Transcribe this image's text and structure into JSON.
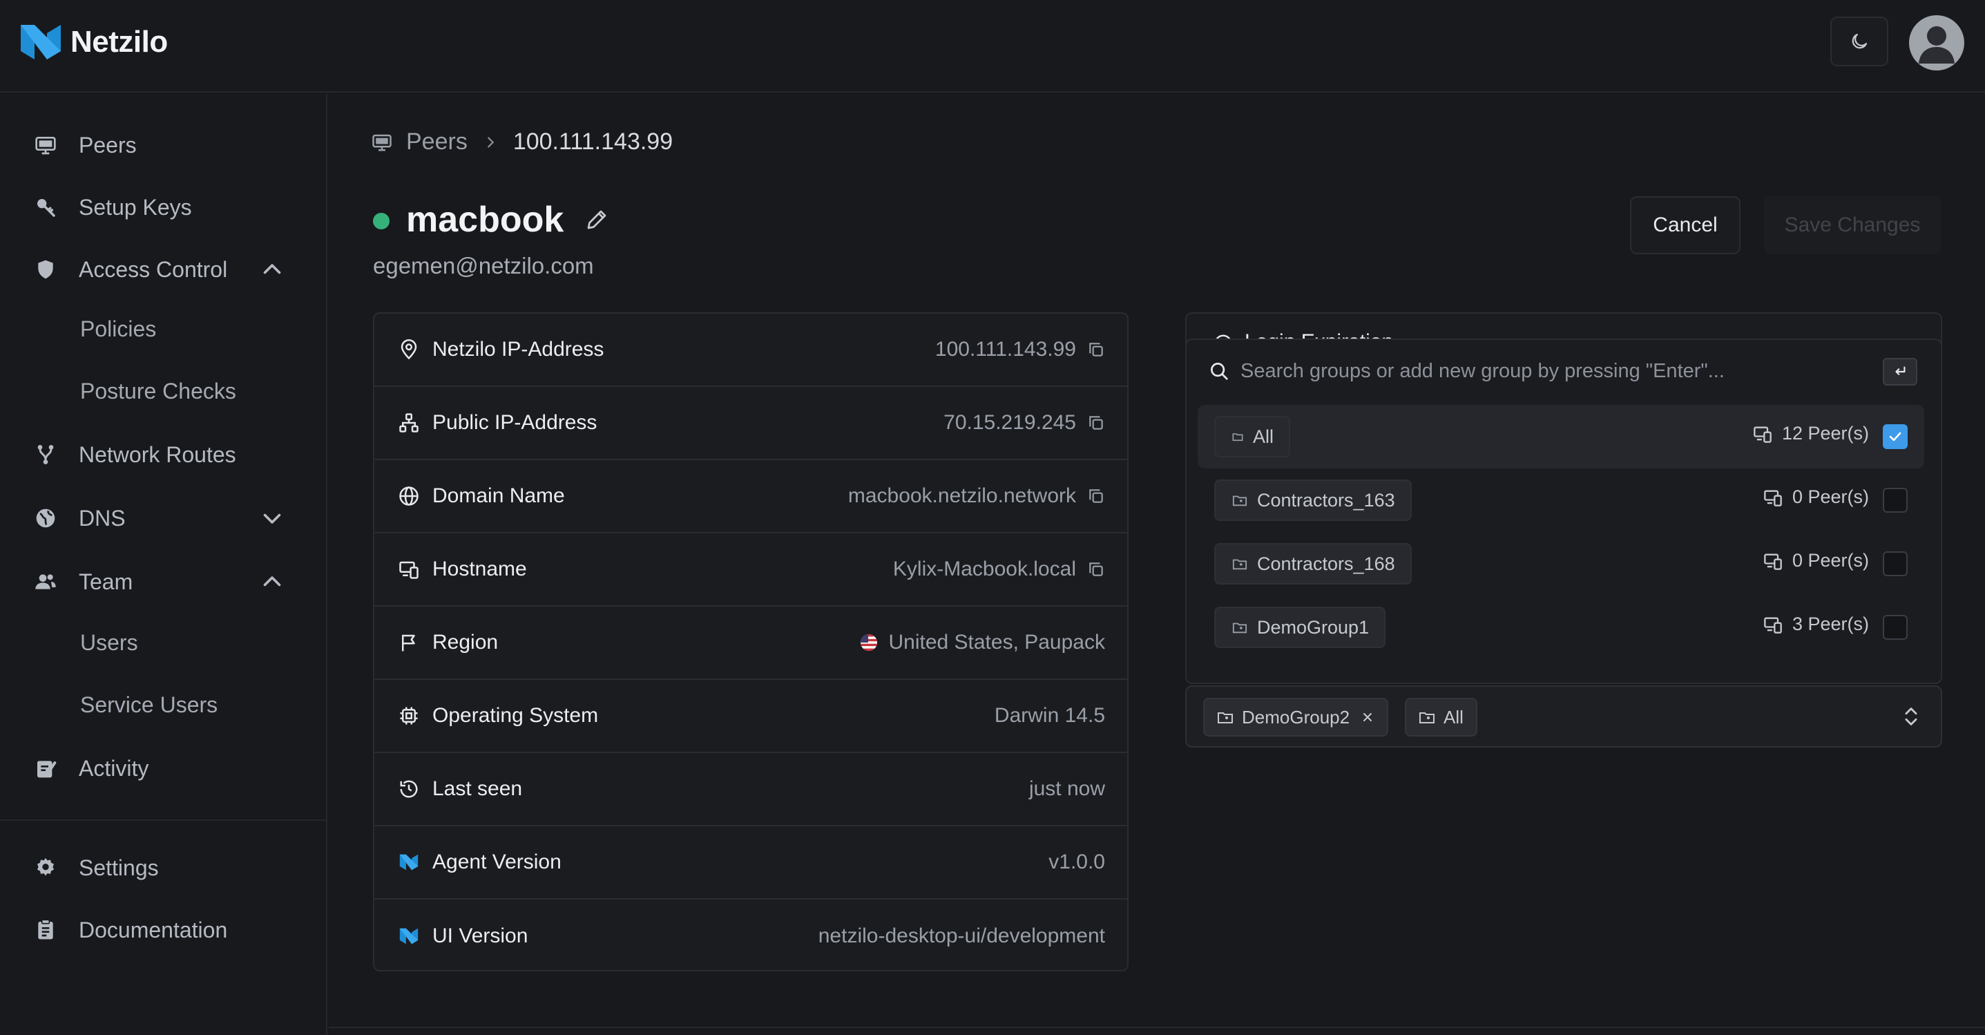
{
  "app": {
    "name": "Netzilo"
  },
  "sidebar": {
    "items": [
      {
        "label": "Peers",
        "icon": "monitor-icon"
      },
      {
        "label": "Setup Keys",
        "icon": "key-icon"
      },
      {
        "label": "Access Control",
        "icon": "shield-icon",
        "expanded": true
      },
      {
        "label": "Policies"
      },
      {
        "label": "Posture Checks"
      },
      {
        "label": "Network Routes",
        "icon": "route-icon"
      },
      {
        "label": "DNS",
        "icon": "globe-icon",
        "expanded": false
      },
      {
        "label": "Team",
        "icon": "users-icon",
        "expanded": true
      },
      {
        "label": "Users"
      },
      {
        "label": "Service Users"
      },
      {
        "label": "Activity",
        "icon": "activity-icon"
      },
      {
        "label": "Settings",
        "icon": "gear-icon"
      },
      {
        "label": "Documentation",
        "icon": "document-icon"
      }
    ]
  },
  "breadcrumb": {
    "root": "Peers",
    "current": "100.111.143.99"
  },
  "peer": {
    "name": "macbook",
    "email": "egemen@netzilo.com",
    "status_color": "#35b27a"
  },
  "actions": {
    "cancel": "Cancel",
    "save": "Save Changes"
  },
  "info": {
    "rows": [
      {
        "label": "Netzilo IP-Address",
        "value": "100.111.143.99",
        "icon": "map-pin-icon",
        "copy": true
      },
      {
        "label": "Public IP-Address",
        "value": "70.15.219.245",
        "icon": "network-icon",
        "copy": true
      },
      {
        "label": "Domain Name",
        "value": "macbook.netzilo.network",
        "icon": "globe-icon",
        "copy": true
      },
      {
        "label": "Hostname",
        "value": "Kylix-Macbook.local",
        "icon": "devices-icon",
        "copy": true
      },
      {
        "label": "Region",
        "value": "United States, Paupack",
        "icon": "flag-icon",
        "copy": false
      },
      {
        "label": "Operating System",
        "value": "Darwin 14.5",
        "icon": "cpu-icon",
        "copy": false
      },
      {
        "label": "Last seen",
        "value": "just now",
        "icon": "history-icon",
        "copy": false
      },
      {
        "label": "Agent Version",
        "value": "v1.0.0",
        "icon": "netzilo-icon",
        "copy": false
      },
      {
        "label": "UI Version",
        "value": "netzilo-desktop-ui/development",
        "icon": "netzilo-icon",
        "copy": false
      }
    ]
  },
  "login": {
    "title": "Login Expiration"
  },
  "groups_dropdown": {
    "search_placeholder": "Search groups or add new group by pressing \"Enter\"...",
    "groups": [
      {
        "name": "All",
        "peers": "12 Peer(s)",
        "checked": true
      },
      {
        "name": "Contractors_163",
        "peers": "0 Peer(s)",
        "checked": false
      },
      {
        "name": "Contractors_168",
        "peers": "0 Peer(s)",
        "checked": false
      },
      {
        "name": "DemoGroup1",
        "peers": "3 Peer(s)",
        "checked": false
      }
    ]
  },
  "selected_groups": [
    {
      "name": "DemoGroup2",
      "removable": true
    },
    {
      "name": "All",
      "removable": false
    }
  ],
  "colors": {
    "accent": "#3d9be9",
    "background": "#18191d",
    "card": "#1b1c20"
  }
}
